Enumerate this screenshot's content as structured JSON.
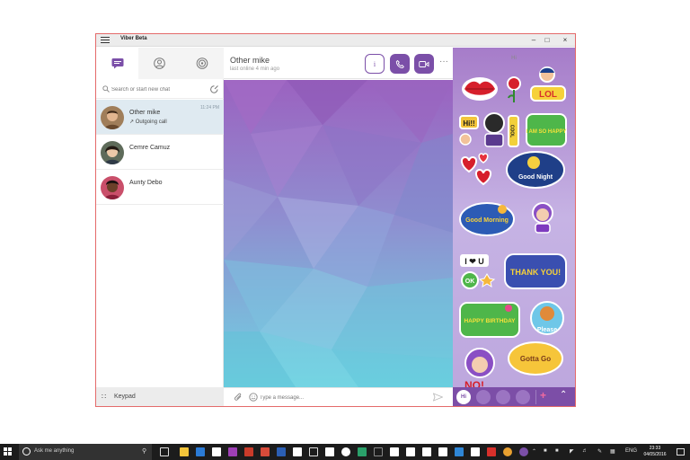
{
  "window": {
    "title": "Viber Beta"
  },
  "tabs": [
    {
      "name": "chats-icon",
      "active": true
    },
    {
      "name": "contacts-icon",
      "active": false
    },
    {
      "name": "public-chats-icon",
      "active": false
    }
  ],
  "search": {
    "placeholder": "Search or start new chat"
  },
  "chats": [
    {
      "name": "Other mike",
      "sub": "↗ Outgoing call",
      "time": "11:24 PM",
      "active": true
    },
    {
      "name": "Cemre Camuz",
      "sub": "",
      "time": "",
      "active": false
    },
    {
      "name": "Aunty Debo",
      "sub": "",
      "time": "",
      "active": false
    }
  ],
  "keypad": {
    "label": "Keypad"
  },
  "conversation": {
    "contact_name": "Other mike",
    "status": "last online 4 min ago",
    "more": "···"
  },
  "composer": {
    "placeholder": "Type a message..."
  },
  "sticker_panel": {
    "title": "Hi",
    "stickers": [
      {
        "name": "kiss-lips-sticker"
      },
      {
        "name": "rose-sticker"
      },
      {
        "name": "lol-sticker",
        "text": "LOL"
      },
      {
        "name": "hi-sticker",
        "text": "Hi!!"
      },
      {
        "name": "bear-sticker"
      },
      {
        "name": "cool-sticker",
        "text": "COOL"
      },
      {
        "name": "i-am-so-happy-sticker",
        "text": "I AM SO HAPPY"
      },
      {
        "name": "hearts-sticker"
      },
      {
        "name": "good-night-sticker",
        "text": "Good Night"
      },
      {
        "name": "good-morning-sticker",
        "text": "Good Morning"
      },
      {
        "name": "girl-sticker"
      },
      {
        "name": "i-love-u-sticker",
        "text": "I ❤ U"
      },
      {
        "name": "ok-sticker",
        "text": "OK"
      },
      {
        "name": "thank-you-sticker",
        "text": "THANK YOU!"
      },
      {
        "name": "happy-birthday-sticker",
        "text": "HAPPY BIRTHDAY"
      },
      {
        "name": "please-sticker",
        "text": "Please"
      },
      {
        "name": "angry-sticker"
      },
      {
        "name": "gotta-go-sticker",
        "text": "Gotta Go"
      },
      {
        "name": "no-sticker",
        "text": "NO!"
      }
    ],
    "bar": {
      "hi_label": "Hi"
    }
  },
  "taskbar": {
    "search_text": "Ask me anything",
    "tray_lang": "ENG",
    "clock_time": "23:33",
    "clock_date": "04/05/2016"
  },
  "colors": {
    "accent": "#7b4fa8",
    "sticker_bar": "#7c4ea7",
    "window_border": "#e46a6a"
  }
}
